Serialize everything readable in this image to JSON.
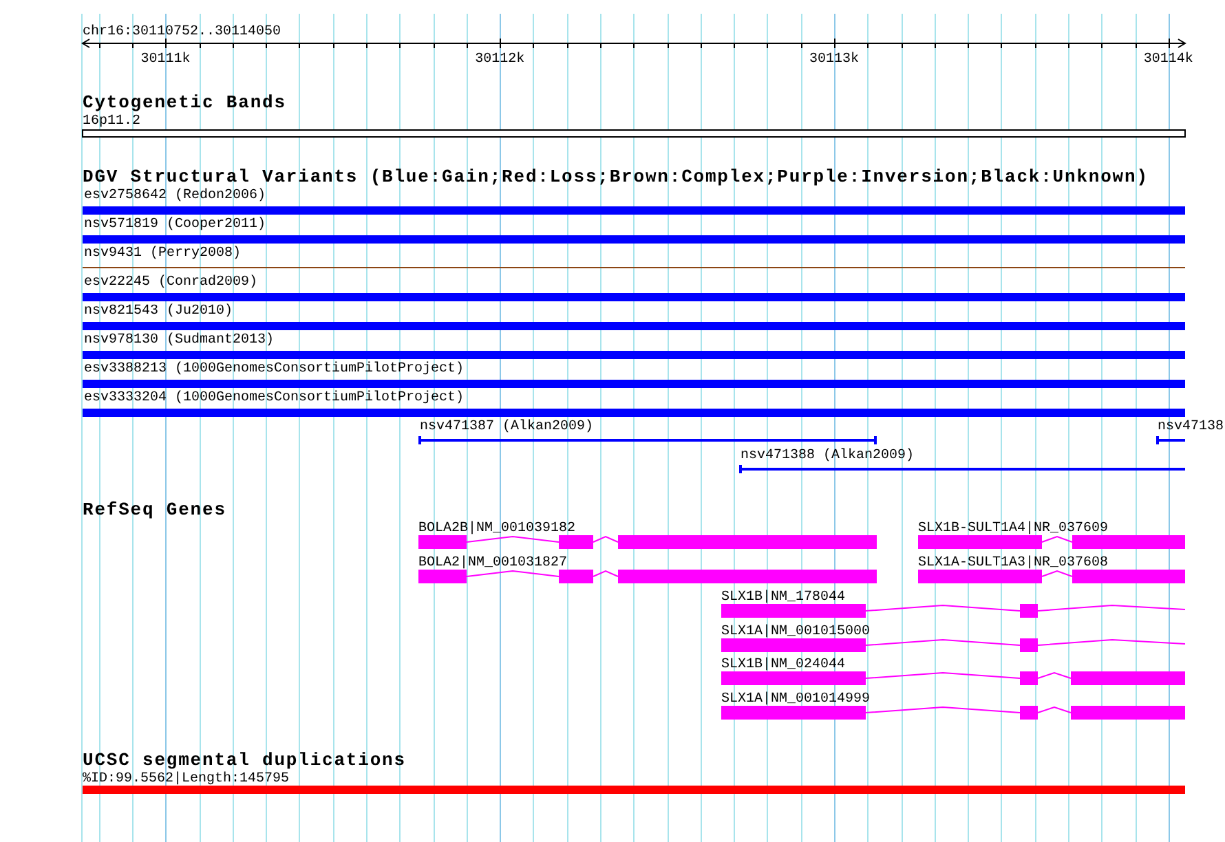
{
  "locus": "chr16:30110752..30114050",
  "ruler": {
    "ticks": [
      "30111k",
      "30112k",
      "30113k",
      "30114k"
    ]
  },
  "cytobands": {
    "title": "Cytogenetic Bands",
    "label": "16p11.2"
  },
  "variants": {
    "title": "DGV Structural Variants (Blue:Gain;Red:Loss;Brown:Complex;Purple:Inversion;Black:Unknown)",
    "features": [
      {
        "label": "esv2758642 (Redon2006)",
        "kind": "bar",
        "color": "#0000ff"
      },
      {
        "label": "nsv571819 (Cooper2011)",
        "kind": "bar",
        "color": "#0000ff"
      },
      {
        "label": "nsv9431 (Perry2008)",
        "kind": "line",
        "color": "#8b4513"
      },
      {
        "label": "esv22245 (Conrad2009)",
        "kind": "bar",
        "color": "#0000ff"
      },
      {
        "label": "nsv821543 (Ju2010)",
        "kind": "bar",
        "color": "#0000ff"
      },
      {
        "label": "nsv978130 (Sudmant2013)",
        "kind": "bar",
        "color": "#0000ff"
      },
      {
        "label": "esv3388213 (1000GenomesConsortiumPilotProject)",
        "kind": "bar",
        "color": "#0000ff"
      },
      {
        "label": "esv3333204 (1000GenomesConsortiumPilotProject)",
        "kind": "bar",
        "color": "#0000ff"
      },
      {
        "label": "nsv471387 (Alkan2009)",
        "kind": "line",
        "color": "#0000ff"
      },
      {
        "label": "nsv47138",
        "kind": "line",
        "color": "#0000ff"
      },
      {
        "label": "nsv471388 (Alkan2009)",
        "kind": "line",
        "color": "#0000ff"
      }
    ]
  },
  "genes": {
    "title": "RefSeq Genes",
    "features": [
      {
        "label": "BOLA2B|NM_001039182"
      },
      {
        "label": "SLX1B-SULT1A4|NR_037609"
      },
      {
        "label": "BOLA2|NM_001031827"
      },
      {
        "label": "SLX1A-SULT1A3|NR_037608"
      },
      {
        "label": "SLX1B|NM_178044"
      },
      {
        "label": "SLX1A|NM_001015000"
      },
      {
        "label": "SLX1B|NM_024044"
      },
      {
        "label": "SLX1A|NM_001014999"
      }
    ]
  },
  "segdups": {
    "title": "UCSC segmental duplications",
    "label": "%ID:99.5562|Length:145795"
  }
}
